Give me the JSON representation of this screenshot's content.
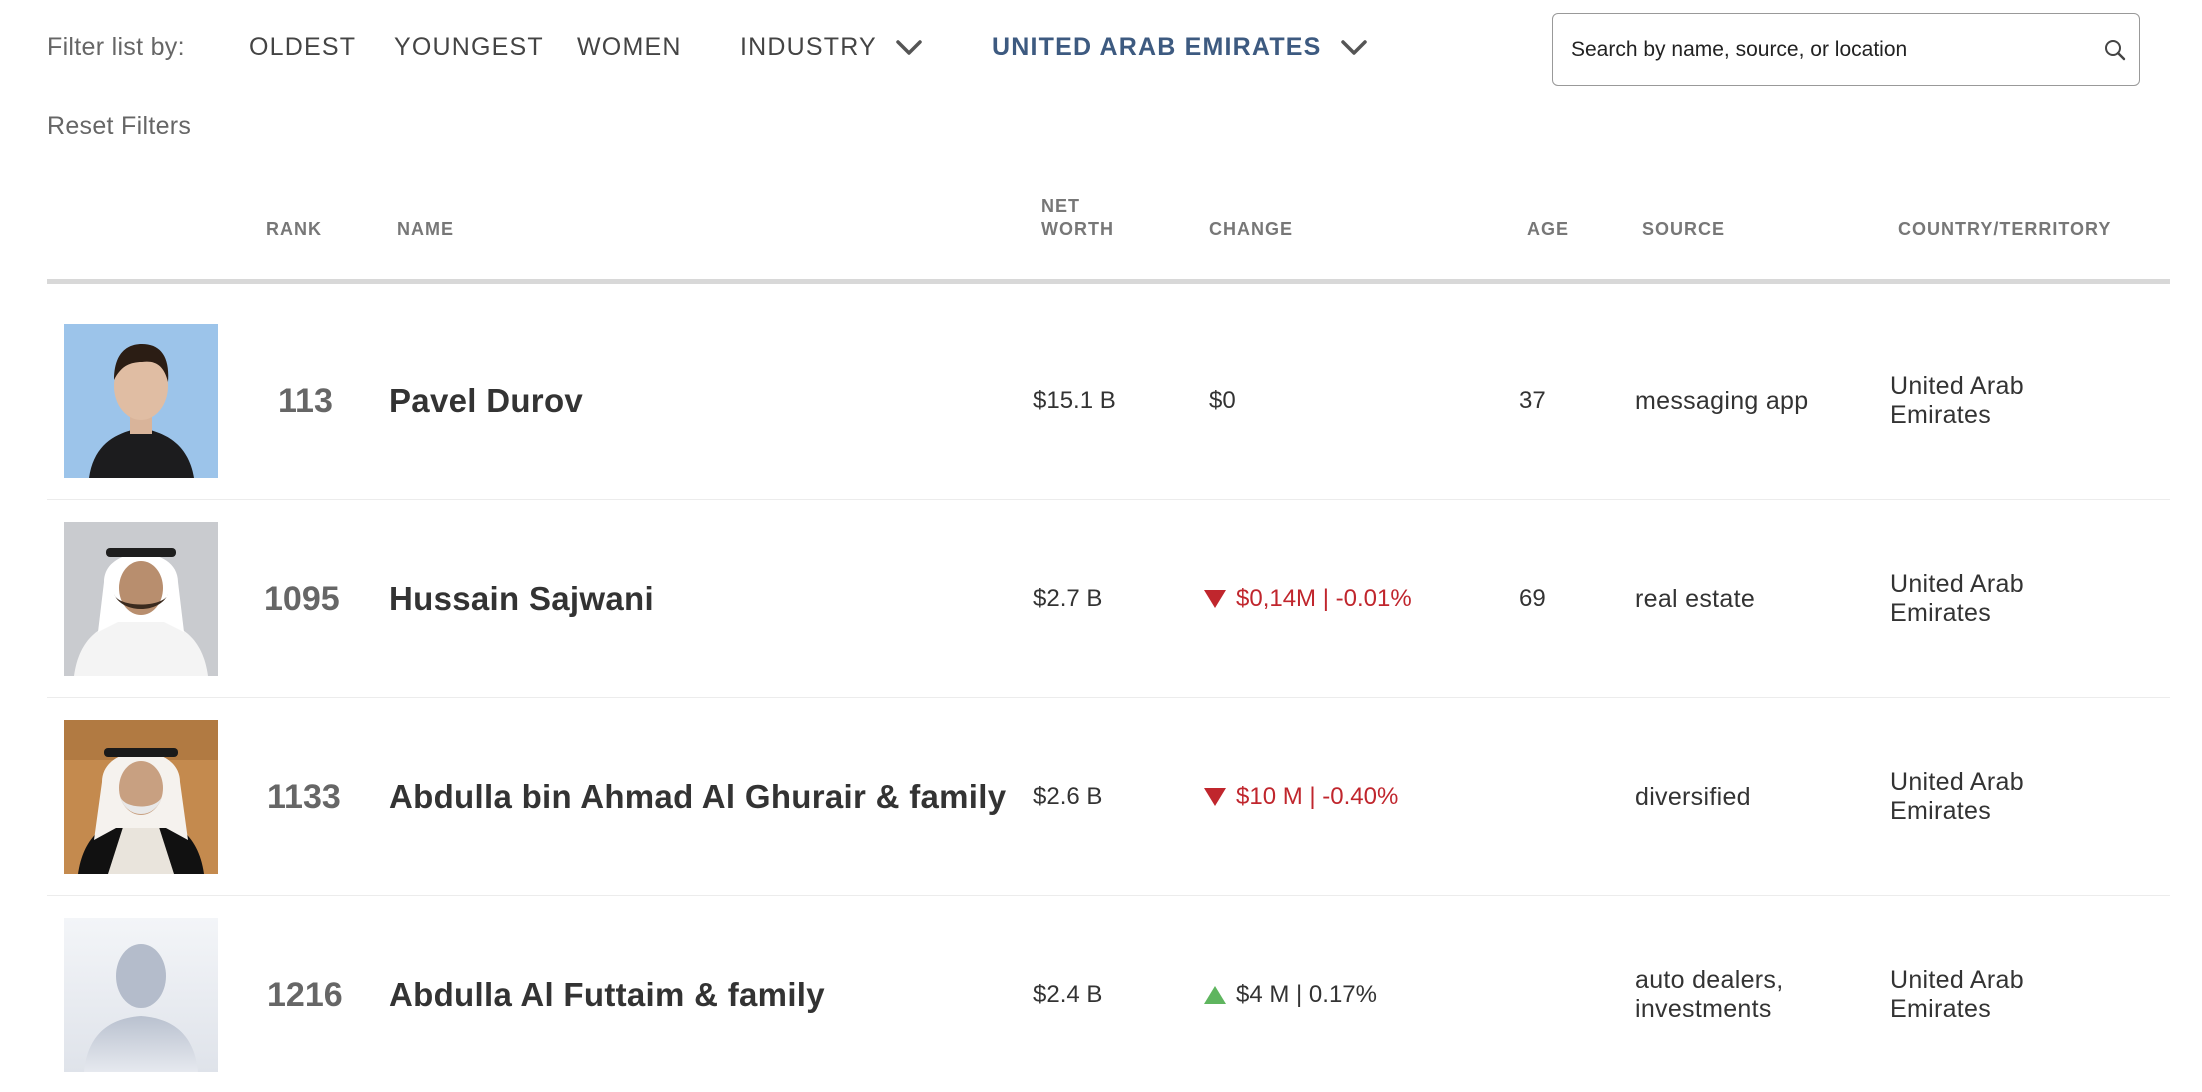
{
  "filters": {
    "label": "Filter list by:",
    "options": [
      "OLDEST",
      "YOUNGEST",
      "WOMEN"
    ],
    "industry": "INDUSTRY",
    "country": "UNITED ARAB EMIRATES",
    "reset": "Reset Filters",
    "active_color": "#3d5a80"
  },
  "search": {
    "placeholder": "Search by name, source, or location"
  },
  "table": {
    "headers": {
      "rank": "RANK",
      "name": "NAME",
      "networth_1": "NET",
      "networth_2": "WORTH",
      "change": "CHANGE",
      "age": "AGE",
      "source": "SOURCE",
      "country": "COUNTRY/TERRITORY"
    },
    "rows": [
      {
        "photo": "person-photo-pavel-durov",
        "rank": "113",
        "name": "Pavel Durov",
        "networth": "$15.1 B",
        "change_dir": "flat",
        "change": "$0",
        "age": "37",
        "source_1": "messaging app",
        "source_2": "",
        "country_1": "United Arab",
        "country_2": "Emirates"
      },
      {
        "photo": "person-photo-hussain-sajwani",
        "rank": "1095",
        "name": "Hussain Sajwani",
        "networth": "$2.7 B",
        "change_dir": "down",
        "change": "$0,14M | -0.01%",
        "age": "69",
        "source_1": "real estate",
        "source_2": "",
        "country_1": "United Arab",
        "country_2": "Emirates"
      },
      {
        "photo": "person-photo-abdulla-al-ghurair",
        "rank": "1133",
        "name": "Abdulla bin Ahmad Al Ghurair & family",
        "networth": "$2.6 B",
        "change_dir": "down",
        "change": "$10 M | -0.40%",
        "age": "",
        "source_1": "diversified",
        "source_2": "",
        "country_1": "United Arab",
        "country_2": "Emirates"
      },
      {
        "photo": "person-silhouette-placeholder",
        "rank": "1216",
        "name": "Abdulla Al Futtaim & family",
        "networth": "$2.4 B",
        "change_dir": "up",
        "change": "$4 M | 0.17%",
        "age": "",
        "source_1": "auto dealers,",
        "source_2": "investments",
        "country_1": "United Arab",
        "country_2": "Emirates"
      }
    ]
  },
  "colors": {
    "down": "#c0262d",
    "up": "#5fb55f"
  }
}
